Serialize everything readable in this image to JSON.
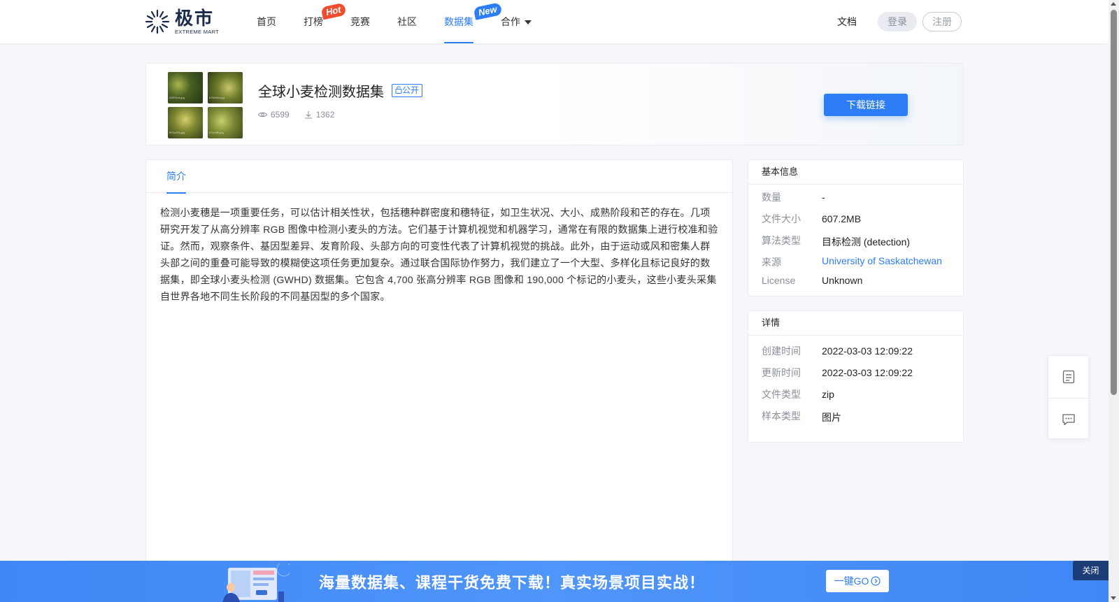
{
  "header": {
    "logo_cn": "极市",
    "logo_en": "EXTREME MART",
    "nav": [
      {
        "label": "首页"
      },
      {
        "label": "打榜",
        "badge": "Hot"
      },
      {
        "label": "竞赛"
      },
      {
        "label": "社区"
      },
      {
        "label": "数据集",
        "badge": "New",
        "active": true
      },
      {
        "label": "合作"
      }
    ],
    "docs": "文档",
    "login": "登录",
    "register": "注册"
  },
  "dataset": {
    "title": "全球小麦检测数据集",
    "visibility": "公开",
    "views": "6599",
    "downloads": "1362",
    "download_button": "下载链接",
    "thumb_captions": [
      "2587bca.jpg",
      "8764d3a.jpg",
      "6f7ea7fa.jpg",
      "67c1f3b.jpg"
    ]
  },
  "intro": {
    "tab": "简介",
    "text": "检测小麦穗是一项重要任务，可以估计相关性状，包括穗种群密度和穗特征，如卫生状况、大小、成熟阶段和芒的存在。几项研究开发了从高分辨率 RGB 图像中检测小麦头的方法。它们基于计算机视觉和机器学习，通常在有限的数据集上进行校准和验证。然而，观察条件、基因型差异、发育阶段、头部方向的可变性代表了计算机视觉的挑战。此外，由于运动或风和密集人群头部之间的重叠可能导致的模糊使这项任务更加复杂。通过联合国际协作努力，我们建立了一个大型、多样化且标记良好的数据集，即全球小麦头检测 (GWHD) 数据集。它包含 4,700 张高分辨率 RGB 图像和 190,000 个标记的小麦头，这些小麦头采集自世界各地不同生长阶段的不同基因型的多个国家。"
  },
  "basic_info": {
    "title": "基本信息",
    "rows": [
      {
        "key": "数量",
        "value": "-"
      },
      {
        "key": "文件大小",
        "value": "607.2MB"
      },
      {
        "key": "算法类型",
        "value": "目标检测 (detection)"
      },
      {
        "key": "来源",
        "value": "University of Saskatchewan"
      },
      {
        "key": "License",
        "value": "Unknown"
      }
    ]
  },
  "details": {
    "title": "详情",
    "rows": [
      {
        "key": "创建时间",
        "value": "2022-03-03 12:09:22"
      },
      {
        "key": "更新时间",
        "value": "2022-03-03 12:09:22"
      },
      {
        "key": "文件类型",
        "value": "zip"
      },
      {
        "key": "样本类型",
        "value": "图片"
      }
    ]
  },
  "banner": {
    "text": "海量数据集、课程干货免费下载！真实场景项目实战！",
    "button": "一键GO",
    "close": "关闭"
  },
  "colors": {
    "accent": "#2d7df6",
    "hot_badge": "#f04d2f",
    "banner": "#4a90f7"
  },
  "icons": [
    "logo-icon",
    "eye-icon",
    "download-icon",
    "lock-icon",
    "document-icon",
    "chat-icon",
    "arrow-circle-right-icon"
  ]
}
